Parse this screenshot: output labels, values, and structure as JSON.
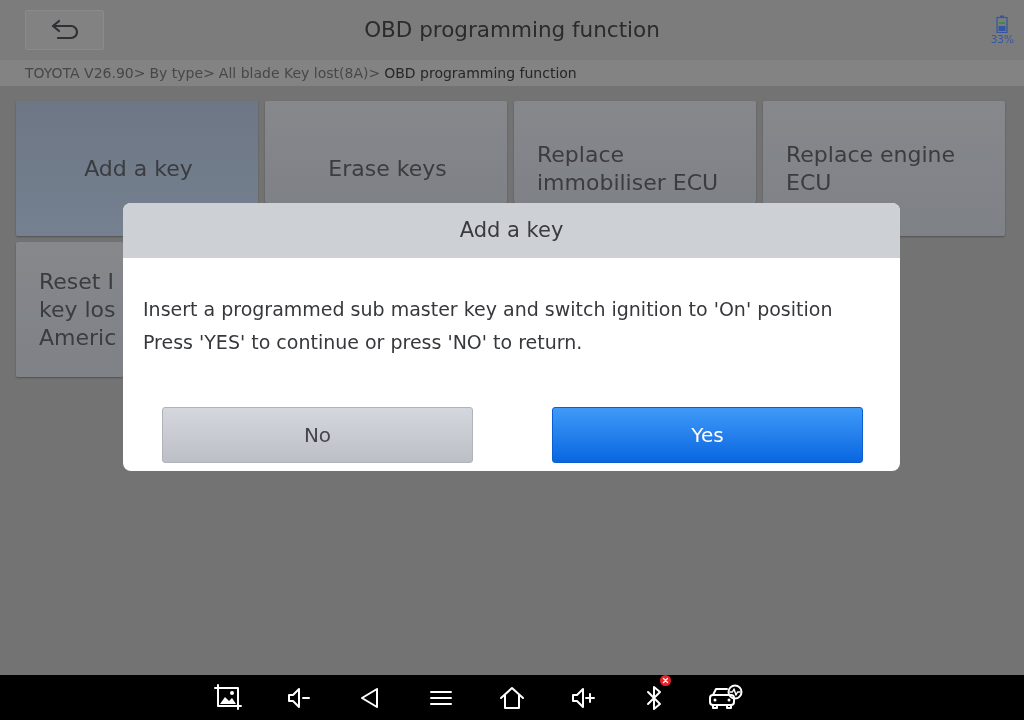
{
  "header": {
    "title": "OBD programming function",
    "battery_text": "33%"
  },
  "breadcrumb": [
    {
      "label": "TOYOTA V26.90",
      "separator": ">",
      "selected": false
    },
    {
      "label": "By type",
      "separator": ">",
      "selected": false
    },
    {
      "label": "All blade Key lost(8A)",
      "separator": ">",
      "selected": false
    },
    {
      "label": "OBD programming function",
      "selected": true
    }
  ],
  "functions": [
    {
      "label": "Add a key",
      "selected": true
    },
    {
      "label": "Erase keys",
      "selected": false
    },
    {
      "label": "Replace immobiliser ECU",
      "selected": false
    },
    {
      "label": "Replace engine ECU",
      "selected": false
    },
    {
      "lines": [
        "Reset I",
        "key los",
        "Americ"
      ],
      "selected": false
    }
  ],
  "dialog": {
    "title": "Add a key",
    "message": "Insert a programmed sub master key and switch ignition to 'On' position\nPress 'YES' to continue or press 'NO' to return.",
    "buttons": [
      {
        "label": "No",
        "kind": "secondary"
      },
      {
        "label": "Yes",
        "kind": "primary"
      }
    ]
  }
}
